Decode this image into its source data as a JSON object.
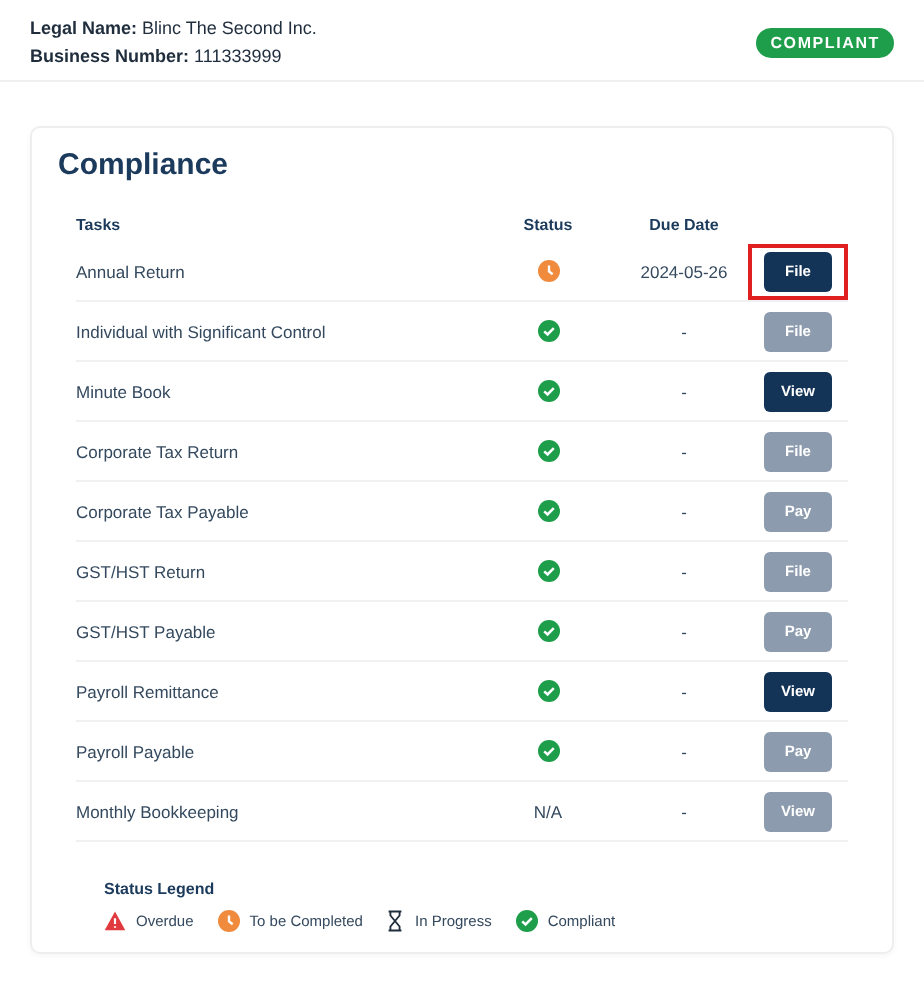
{
  "business": {
    "legal_name_label": "Legal Name:",
    "legal_name": "Blinc The Second Inc.",
    "number_label": "Business Number:",
    "number": "111333999",
    "badge": "COMPLIANT"
  },
  "compliance": {
    "title": "Compliance",
    "columns": [
      "Tasks",
      "Status",
      "Due Date"
    ],
    "rows": [
      {
        "task": "Annual Return",
        "status": {
          "kind": "to_be_completed"
        },
        "due": "2024-05-26",
        "action": {
          "label": "File",
          "disabled": false,
          "highlighted": true
        }
      },
      {
        "task": "Individual with Significant Control",
        "status": {
          "kind": "compliant"
        },
        "due": "-",
        "action": {
          "label": "File",
          "disabled": true,
          "highlighted": false
        }
      },
      {
        "task": "Minute Book",
        "status": {
          "kind": "compliant"
        },
        "due": "-",
        "action": {
          "label": "View",
          "disabled": false,
          "highlighted": false
        }
      },
      {
        "task": "Corporate Tax Return",
        "status": {
          "kind": "compliant"
        },
        "due": "-",
        "action": {
          "label": "File",
          "disabled": true,
          "highlighted": false
        }
      },
      {
        "task": "Corporate Tax Payable",
        "status": {
          "kind": "compliant"
        },
        "due": "-",
        "action": {
          "label": "Pay",
          "disabled": true,
          "highlighted": false
        }
      },
      {
        "task": "GST/HST Return",
        "status": {
          "kind": "compliant"
        },
        "due": "-",
        "action": {
          "label": "File",
          "disabled": true,
          "highlighted": false
        }
      },
      {
        "task": "GST/HST Payable",
        "status": {
          "kind": "compliant"
        },
        "due": "-",
        "action": {
          "label": "Pay",
          "disabled": true,
          "highlighted": false
        }
      },
      {
        "task": "Payroll Remittance",
        "status": {
          "kind": "compliant"
        },
        "due": "-",
        "action": {
          "label": "View",
          "disabled": false,
          "highlighted": false
        }
      },
      {
        "task": "Payroll Payable",
        "status": {
          "kind": "compliant"
        },
        "due": "-",
        "action": {
          "label": "Pay",
          "disabled": true,
          "highlighted": false
        }
      },
      {
        "task": "Monthly Bookkeeping",
        "status": {
          "kind": "text",
          "text": "N/A"
        },
        "due": "-",
        "action": {
          "label": "View",
          "disabled": true,
          "highlighted": false
        }
      }
    ],
    "legend": {
      "title": "Status Legend",
      "items": [
        {
          "kind": "overdue",
          "label": "Overdue"
        },
        {
          "kind": "to_be_completed",
          "label": "To be Completed"
        },
        {
          "kind": "in_progress",
          "label": "In Progress"
        },
        {
          "kind": "compliant",
          "label": "Compliant"
        }
      ]
    }
  }
}
